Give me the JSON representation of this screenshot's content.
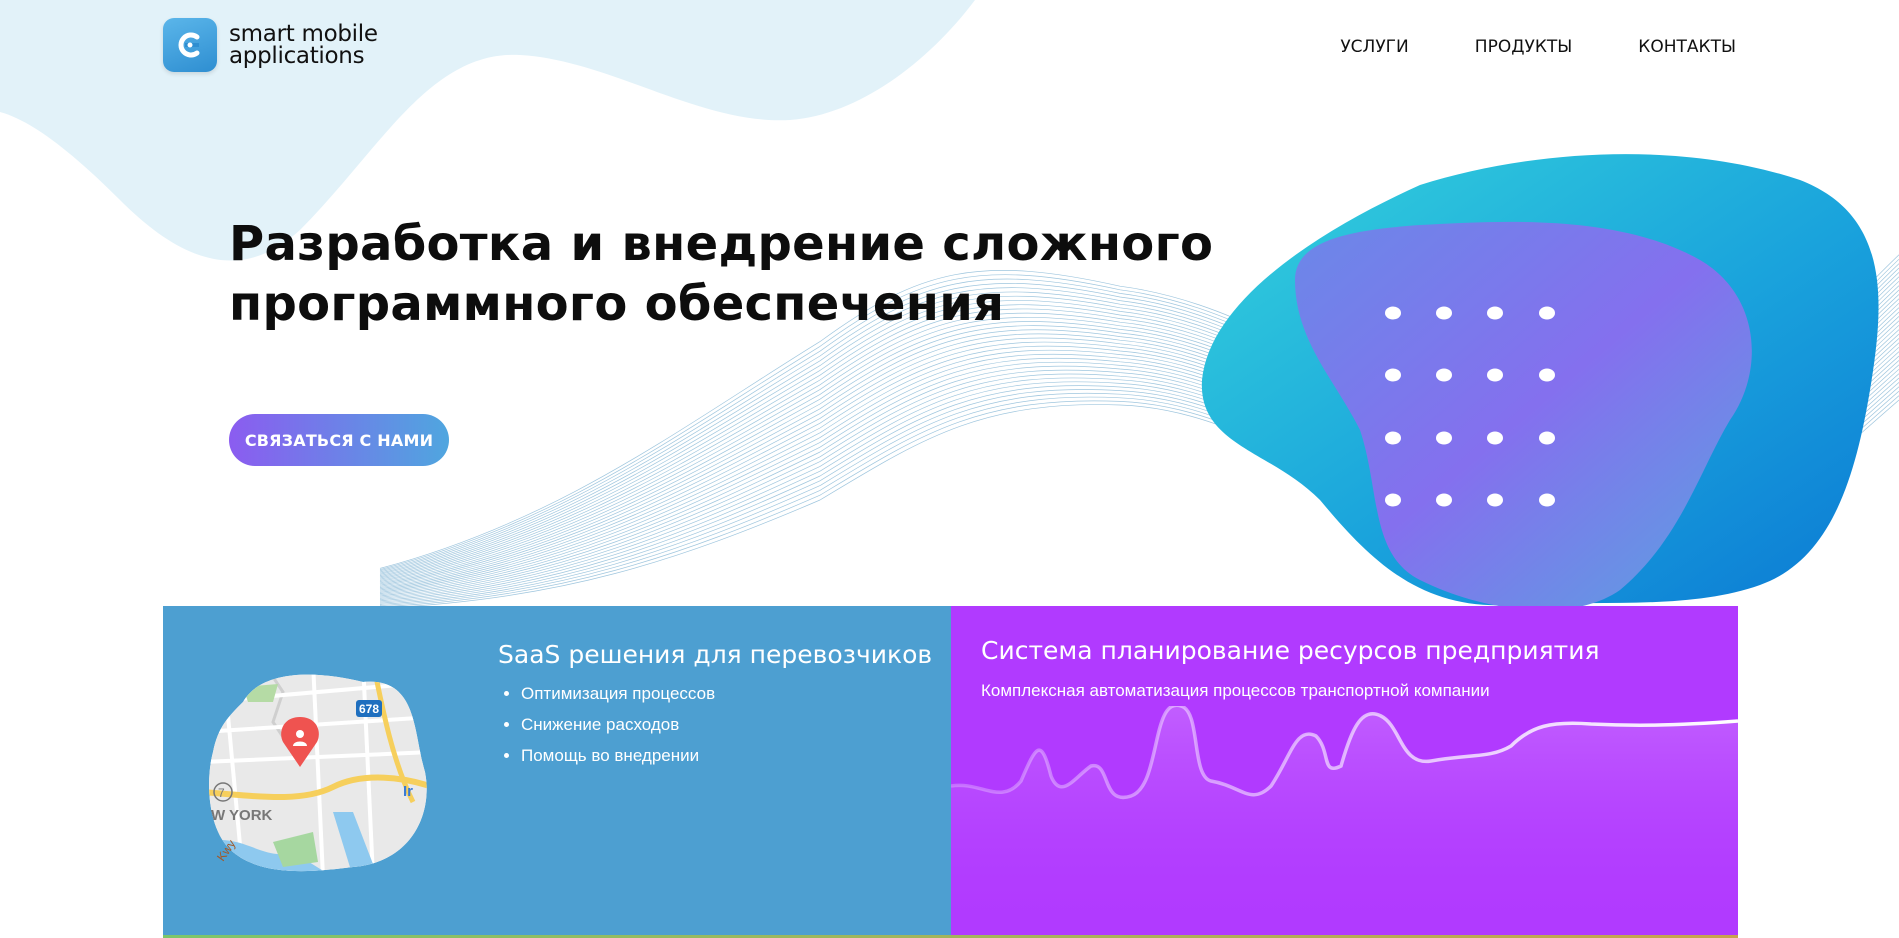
{
  "brand": {
    "name_line1": "smart mobile",
    "name_line2": "applications",
    "logo_icon": "app-logo-icon",
    "color": "#3b96d6"
  },
  "nav": {
    "items": [
      {
        "label": "УСЛУГИ"
      },
      {
        "label": "ПРОДУКТЫ"
      },
      {
        "label": "КОНТАКТЫ"
      }
    ]
  },
  "hero": {
    "title_line1": "Разработка и внедрение сложного",
    "title_line2": "программного обеспечения",
    "cta_label": "СВЯЗАТЬСЯ С НАМИ",
    "cta_gradient": [
      "#8b5cf0",
      "#4fa6df"
    ]
  },
  "cards": [
    {
      "title": "SaaS решения для перевозчиков",
      "bullets": [
        "Оптимизация процессов",
        "Снижение расходов",
        "Помощь во внедрении"
      ],
      "map_labels": {
        "highway": "678",
        "city": "W YORK",
        "partial_left": "7",
        "partial_right": "Ir",
        "road": "Kwy"
      },
      "color": "#4d9fd1"
    },
    {
      "title": "Система планирование ресурсов предприятия",
      "subtitle": "Комплексная автоматизация процессов транспортной компании",
      "color": "#b13aff"
    }
  ],
  "colors": {
    "blob_cyan": "#2ec8dc",
    "blob_blue": "#1a86d8",
    "blob_purple": "#8a6cf0",
    "top_wave": "#e2f2f9"
  }
}
